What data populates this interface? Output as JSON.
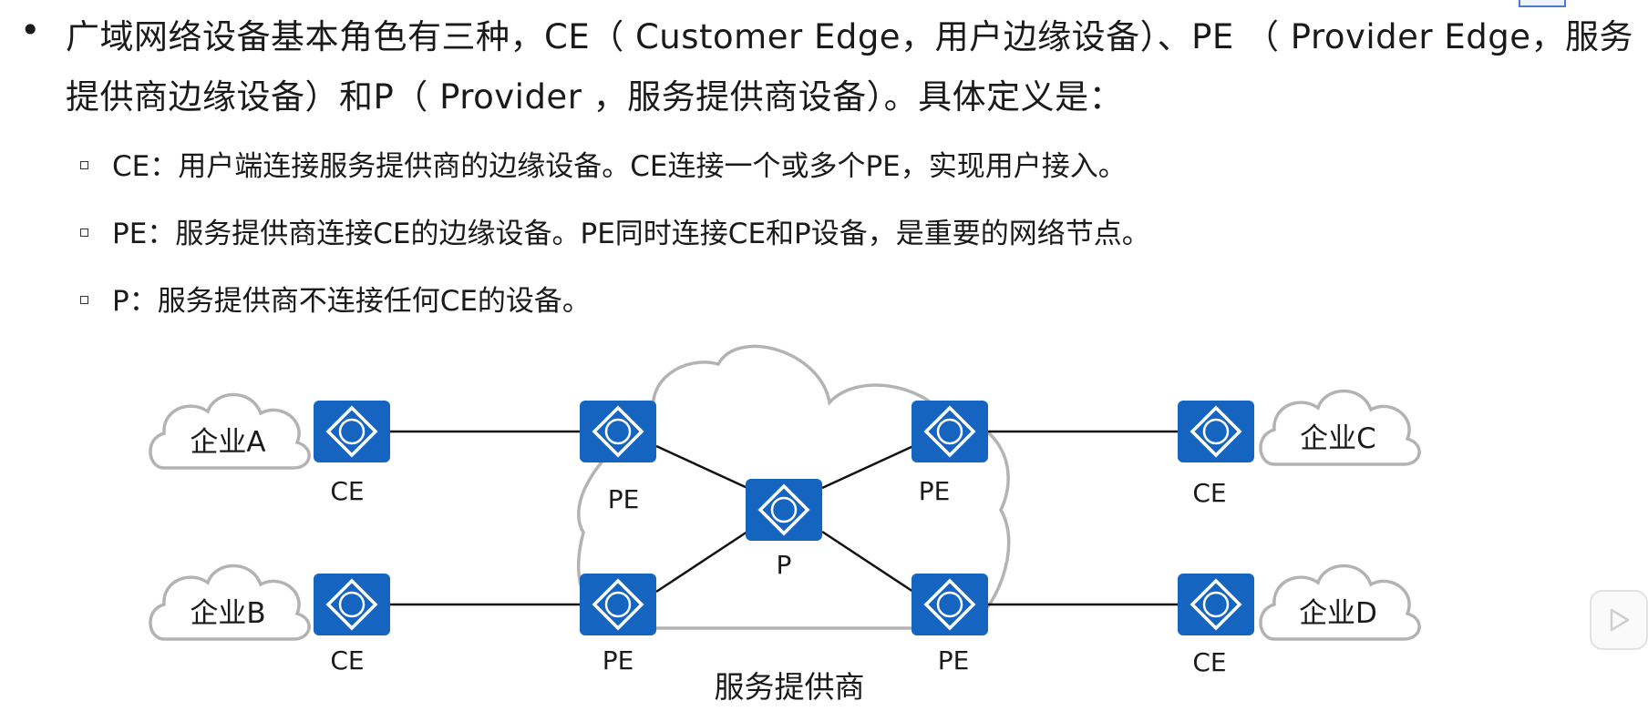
{
  "intro": {
    "bullet": "•",
    "text": "广域网络设备基本角色有三种，CE（ Customer Edge，用户边缘设备）、PE （ Provider Edge，服务提供商边缘设备）和P（ Provider ，服务提供商设备）。具体定义是："
  },
  "definitions": [
    {
      "text": "CE：用户端连接服务提供商的边缘设备。CE连接一个或多个PE，实现用户接入。"
    },
    {
      "text": "PE：服务提供商连接CE的边缘设备。PE同时连接CE和P设备，是重要的网络节点。"
    },
    {
      "text": "P：服务提供商不连接任何CE的设备。"
    }
  ],
  "diagram": {
    "router_glyph": "R",
    "router_color": "#1565c0",
    "cloud_stroke": "#b3b3b3",
    "provider_label": "服务提供商",
    "enterprises": [
      "企业A",
      "企业B",
      "企业C",
      "企业D"
    ],
    "device_labels": {
      "ce_a": "CE",
      "pe_a": "PE",
      "p": "P",
      "pe_c": "PE",
      "ce_c": "CE",
      "ce_b": "CE",
      "pe_b": "PE",
      "pe_d": "PE",
      "ce_d": "CE"
    }
  },
  "icons": {
    "router": "router-icon",
    "cloud": "cloud-icon",
    "side_button": "play-icon"
  }
}
